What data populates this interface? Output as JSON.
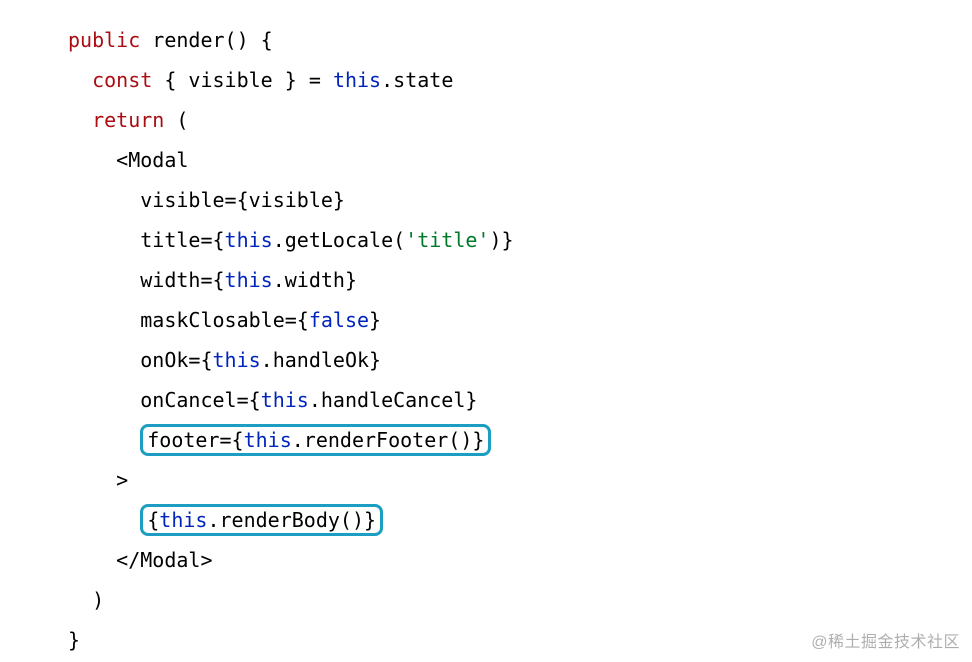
{
  "code": {
    "lines": [
      {
        "indent": 0,
        "parts": [
          {
            "cls": "kw1",
            "text": "public"
          },
          {
            "cls": "plain",
            "text": " render() {"
          }
        ]
      },
      {
        "indent": 1,
        "parts": [
          {
            "cls": "kw1",
            "text": "const"
          },
          {
            "cls": "plain",
            "text": " { visible } = "
          },
          {
            "cls": "kw2",
            "text": "this"
          },
          {
            "cls": "plain",
            "text": ".state"
          }
        ]
      },
      {
        "indent": 1,
        "parts": [
          {
            "cls": "kw1",
            "text": "return"
          },
          {
            "cls": "plain",
            "text": " ("
          }
        ]
      },
      {
        "indent": 2,
        "parts": [
          {
            "cls": "plain",
            "text": "<Modal"
          }
        ]
      },
      {
        "indent": 3,
        "parts": [
          {
            "cls": "plain",
            "text": "visible={visible}"
          }
        ]
      },
      {
        "indent": 3,
        "parts": [
          {
            "cls": "plain",
            "text": "title={"
          },
          {
            "cls": "kw2",
            "text": "this"
          },
          {
            "cls": "plain",
            "text": ".getLocale("
          },
          {
            "cls": "string",
            "text": "'title'"
          },
          {
            "cls": "plain",
            "text": ")}"
          }
        ]
      },
      {
        "indent": 3,
        "parts": [
          {
            "cls": "plain",
            "text": "width={"
          },
          {
            "cls": "kw2",
            "text": "this"
          },
          {
            "cls": "plain",
            "text": ".width}"
          }
        ]
      },
      {
        "indent": 3,
        "parts": [
          {
            "cls": "plain",
            "text": "maskClosable={"
          },
          {
            "cls": "kw2",
            "text": "false"
          },
          {
            "cls": "plain",
            "text": "}"
          }
        ]
      },
      {
        "indent": 3,
        "parts": [
          {
            "cls": "plain",
            "text": "onOk={"
          },
          {
            "cls": "kw2",
            "text": "this"
          },
          {
            "cls": "plain",
            "text": ".handleOk}"
          }
        ]
      },
      {
        "indent": 3,
        "parts": [
          {
            "cls": "plain",
            "text": "onCancel={"
          },
          {
            "cls": "kw2",
            "text": "this"
          },
          {
            "cls": "plain",
            "text": ".handleCancel}"
          }
        ]
      },
      {
        "indent": 3,
        "boxed": true,
        "parts": [
          {
            "cls": "plain",
            "text": "footer={"
          },
          {
            "cls": "kw2",
            "text": "this"
          },
          {
            "cls": "plain",
            "text": ".renderFooter()}"
          }
        ]
      },
      {
        "indent": 2,
        "parts": [
          {
            "cls": "plain",
            "text": ">"
          }
        ]
      },
      {
        "indent": 3,
        "boxed": true,
        "parts": [
          {
            "cls": "plain",
            "text": "{"
          },
          {
            "cls": "kw2",
            "text": "this"
          },
          {
            "cls": "plain",
            "text": ".renderBody()}"
          }
        ]
      },
      {
        "indent": 2,
        "parts": [
          {
            "cls": "plain",
            "text": "</Modal>"
          }
        ]
      },
      {
        "indent": 1,
        "parts": [
          {
            "cls": "plain",
            "text": ")"
          }
        ]
      },
      {
        "indent": 0,
        "parts": [
          {
            "cls": "plain",
            "text": "}"
          }
        ]
      }
    ]
  },
  "highlight_color": "#1c9ec2",
  "watermark": "@稀土掘金技术社区"
}
